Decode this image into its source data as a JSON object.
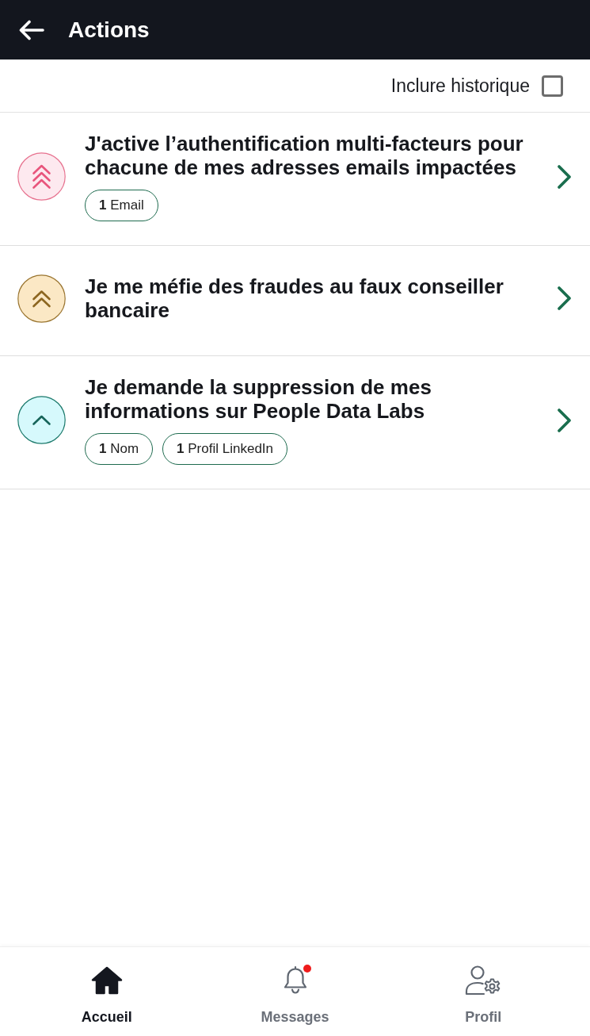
{
  "header": {
    "title": "Actions"
  },
  "filter": {
    "label": "Inclure historique",
    "checked": false
  },
  "actions": [
    {
      "kind": "triple",
      "title": "J'active l’authentification multi-facteurs pour chacune de mes adresses emails impactées",
      "tags": [
        "**1** Email"
      ]
    },
    {
      "kind": "double",
      "title": "Je me méfie des fraudes au faux conseiller bancaire"
    },
    {
      "kind": "single",
      "title": "Je demande la suppression de mes informations sur People Data Labs",
      "tags": [
        "**1** Nom",
        "**1** Profil LinkedIn"
      ]
    }
  ],
  "bottom_nav": [
    {
      "label": "Accueil",
      "selected": true,
      "unread": false
    },
    {
      "label": "Messages",
      "selected": false,
      "unread": true
    },
    {
      "label": "Profil",
      "selected": false,
      "unread": false
    }
  ]
}
